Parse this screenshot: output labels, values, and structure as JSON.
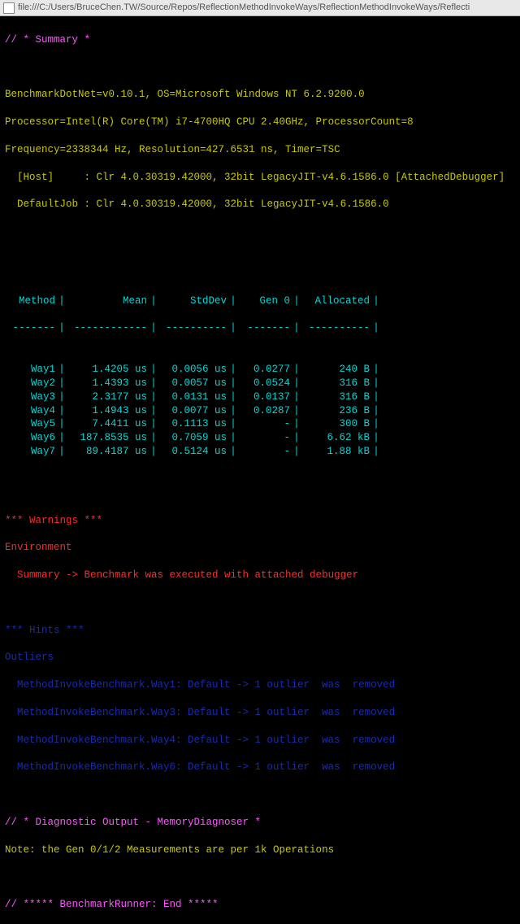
{
  "address_bar": {
    "url": "file:///C:/Users/BruceChen.TW/Source/Repos/ReflectionMethodInvokeWays/ReflectionMethodInvokeWays/Reflecti"
  },
  "header": {
    "summary_label": "// * Summary *",
    "env_lines": [
      "BenchmarkDotNet=v0.10.1, OS=Microsoft Windows NT 6.2.9200.0",
      "Processor=Intel(R) Core(TM) i7-4700HQ CPU 2.40GHz, ProcessorCount=8",
      "Frequency=2338344 Hz, Resolution=427.6531 ns, Timer=TSC",
      "  [Host]     : Clr 4.0.30319.42000, 32bit LegacyJIT-v4.6.1586.0 [AttachedDebugger]",
      "  DefaultJob : Clr 4.0.30319.42000, 32bit LegacyJIT-v4.6.1586.0"
    ]
  },
  "table": {
    "columns": {
      "method": "Method",
      "mean": "Mean",
      "stddev": "StdDev",
      "gen0": "Gen 0",
      "allocated": "Allocated"
    },
    "rows": [
      {
        "method": "Way1",
        "mean": "1.4205 us",
        "stddev": "0.0056 us",
        "gen0": "0.0277",
        "allocated": "240 B"
      },
      {
        "method": "Way2",
        "mean": "1.4393 us",
        "stddev": "0.0057 us",
        "gen0": "0.0524",
        "allocated": "316 B"
      },
      {
        "method": "Way3",
        "mean": "2.3177 us",
        "stddev": "0.0131 us",
        "gen0": "0.0137",
        "allocated": "316 B"
      },
      {
        "method": "Way4",
        "mean": "1.4943 us",
        "stddev": "0.0077 us",
        "gen0": "0.0287",
        "allocated": "236 B"
      },
      {
        "method": "Way5",
        "mean": "7.4411 us",
        "stddev": "0.1113 us",
        "gen0": "-",
        "allocated": "300 B"
      },
      {
        "method": "Way6",
        "mean": "187.8535 us",
        "stddev": "0.7059 us",
        "gen0": "-",
        "allocated": "6.62 kB"
      },
      {
        "method": "Way7",
        "mean": "89.4187 us",
        "stddev": "0.5124 us",
        "gen0": "-",
        "allocated": "1.88 kB"
      }
    ]
  },
  "warnings": {
    "title": "*** Warnings ***",
    "env_label": "Environment",
    "summary": "  Summary -> Benchmark was executed with attached debugger"
  },
  "hints": {
    "title": "*** Hints ***",
    "outliers_label": "Outliers",
    "lines": [
      "  MethodInvokeBenchmark.Way1: Default -> 1 outlier  was  removed",
      "  MethodInvokeBenchmark.Way3: Default -> 1 outlier  was  removed",
      "  MethodInvokeBenchmark.Way4: Default -> 1 outlier  was  removed",
      "  MethodInvokeBenchmark.Way6: Default -> 1 outlier  was  removed"
    ]
  },
  "diag": {
    "title": "// * Diagnostic Output - MemoryDiagnoser *",
    "note": "Note: the Gen 0/1/2 Measurements are per 1k Operations"
  },
  "footer": {
    "end": "// ***** BenchmarkRunner: End *****"
  },
  "pipe": "|"
}
